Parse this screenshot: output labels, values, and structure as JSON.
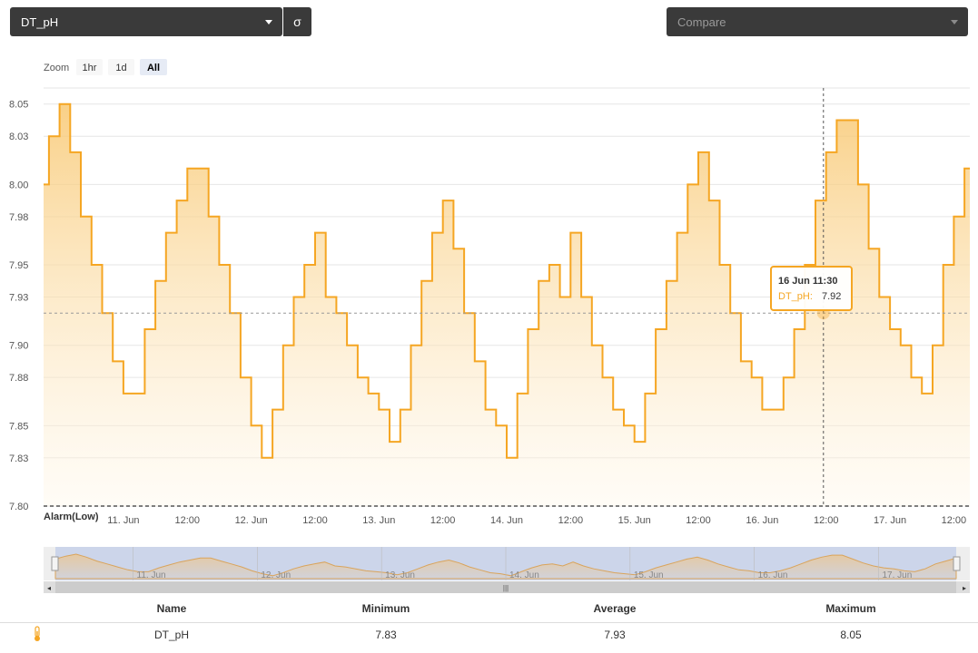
{
  "toolbar": {
    "sensor_selected": "DT_pH",
    "sigma_label": "σ",
    "compare_placeholder": "Compare"
  },
  "zoom": {
    "label": "Zoom",
    "buttons": [
      "1hr",
      "1d",
      "All"
    ],
    "active": "All"
  },
  "tooltip": {
    "date": "16 Jun 11:30",
    "series": "DT_pH:",
    "value": "7.92"
  },
  "alarm_label": "Alarm(Low)",
  "navigator_labels": [
    "11. Jun",
    "12. Jun",
    "13. Jun",
    "14. Jun",
    "15. Jun",
    "16. Jun",
    "17. Jun"
  ],
  "stats": {
    "headers": {
      "name": "Name",
      "minimum": "Minimum",
      "average": "Average",
      "maximum": "Maximum"
    },
    "row": {
      "name": "DT_pH",
      "minimum": "7.83",
      "average": "7.93",
      "maximum": "8.05"
    }
  },
  "colors": {
    "series": "#f5a623",
    "alarm": "#555555",
    "navigator_bg": "#ccd5ea",
    "dark": "#3a3a3a"
  },
  "chart_data": {
    "type": "area",
    "series": [
      {
        "name": "DT_pH",
        "points": [
          [
            "10 Jun 09:00",
            8.0
          ],
          [
            "10 Jun 11:00",
            8.03
          ],
          [
            "10 Jun 13:00",
            8.05
          ],
          [
            "10 Jun 15:00",
            8.02
          ],
          [
            "10 Jun 17:00",
            7.98
          ],
          [
            "10 Jun 19:00",
            7.95
          ],
          [
            "10 Jun 21:00",
            7.92
          ],
          [
            "10 Jun 23:00",
            7.89
          ],
          [
            "11 Jun 01:00",
            7.87
          ],
          [
            "11 Jun 03:00",
            7.87
          ],
          [
            "11 Jun 05:00",
            7.91
          ],
          [
            "11 Jun 07:00",
            7.94
          ],
          [
            "11 Jun 09:00",
            7.97
          ],
          [
            "11 Jun 11:00",
            7.99
          ],
          [
            "11 Jun 13:00",
            8.01
          ],
          [
            "11 Jun 15:00",
            8.01
          ],
          [
            "11 Jun 17:00",
            7.98
          ],
          [
            "11 Jun 19:00",
            7.95
          ],
          [
            "11 Jun 21:00",
            7.92
          ],
          [
            "11 Jun 23:00",
            7.88
          ],
          [
            "12 Jun 01:00",
            7.85
          ],
          [
            "12 Jun 03:00",
            7.83
          ],
          [
            "12 Jun 05:00",
            7.86
          ],
          [
            "12 Jun 07:00",
            7.9
          ],
          [
            "12 Jun 09:00",
            7.93
          ],
          [
            "12 Jun 11:00",
            7.95
          ],
          [
            "12 Jun 13:00",
            7.97
          ],
          [
            "12 Jun 15:00",
            7.93
          ],
          [
            "12 Jun 17:00",
            7.92
          ],
          [
            "12 Jun 19:00",
            7.9
          ],
          [
            "12 Jun 21:00",
            7.88
          ],
          [
            "12 Jun 23:00",
            7.87
          ],
          [
            "13 Jun 01:00",
            7.86
          ],
          [
            "13 Jun 03:00",
            7.84
          ],
          [
            "13 Jun 05:00",
            7.86
          ],
          [
            "13 Jun 07:00",
            7.9
          ],
          [
            "13 Jun 09:00",
            7.94
          ],
          [
            "13 Jun 11:00",
            7.97
          ],
          [
            "13 Jun 13:00",
            7.99
          ],
          [
            "13 Jun 15:00",
            7.96
          ],
          [
            "13 Jun 17:00",
            7.92
          ],
          [
            "13 Jun 19:00",
            7.89
          ],
          [
            "13 Jun 21:00",
            7.86
          ],
          [
            "13 Jun 23:00",
            7.85
          ],
          [
            "14 Jun 01:00",
            7.83
          ],
          [
            "14 Jun 03:00",
            7.87
          ],
          [
            "14 Jun 05:00",
            7.91
          ],
          [
            "14 Jun 07:00",
            7.94
          ],
          [
            "14 Jun 09:00",
            7.95
          ],
          [
            "14 Jun 11:00",
            7.93
          ],
          [
            "14 Jun 13:00",
            7.97
          ],
          [
            "14 Jun 15:00",
            7.93
          ],
          [
            "14 Jun 17:00",
            7.9
          ],
          [
            "14 Jun 19:00",
            7.88
          ],
          [
            "14 Jun 21:00",
            7.86
          ],
          [
            "14 Jun 23:00",
            7.85
          ],
          [
            "15 Jun 01:00",
            7.84
          ],
          [
            "15 Jun 03:00",
            7.87
          ],
          [
            "15 Jun 05:00",
            7.91
          ],
          [
            "15 Jun 07:00",
            7.94
          ],
          [
            "15 Jun 09:00",
            7.97
          ],
          [
            "15 Jun 11:00",
            8.0
          ],
          [
            "15 Jun 13:00",
            8.02
          ],
          [
            "15 Jun 15:00",
            7.99
          ],
          [
            "15 Jun 17:00",
            7.95
          ],
          [
            "15 Jun 19:00",
            7.92
          ],
          [
            "15 Jun 21:00",
            7.89
          ],
          [
            "15 Jun 23:00",
            7.88
          ],
          [
            "16 Jun 01:00",
            7.86
          ],
          [
            "16 Jun 03:00",
            7.86
          ],
          [
            "16 Jun 05:00",
            7.88
          ],
          [
            "16 Jun 07:00",
            7.91
          ],
          [
            "16 Jun 09:00",
            7.95
          ],
          [
            "16 Jun 11:00",
            7.99
          ],
          [
            "16 Jun 13:00",
            8.02
          ],
          [
            "16 Jun 15:00",
            8.04
          ],
          [
            "16 Jun 17:00",
            8.04
          ],
          [
            "16 Jun 19:00",
            8.0
          ],
          [
            "16 Jun 21:00",
            7.96
          ],
          [
            "16 Jun 23:00",
            7.93
          ],
          [
            "17 Jun 01:00",
            7.91
          ],
          [
            "17 Jun 03:00",
            7.9
          ],
          [
            "17 Jun 05:00",
            7.88
          ],
          [
            "17 Jun 07:00",
            7.87
          ],
          [
            "17 Jun 09:00",
            7.9
          ],
          [
            "17 Jun 11:00",
            7.95
          ],
          [
            "17 Jun 13:00",
            7.98
          ],
          [
            "17 Jun 15:00",
            8.01
          ]
        ]
      }
    ],
    "xlabel": "",
    "ylabel": "",
    "x_start": "10 Jun 09:00",
    "x_end": "17 Jun 15:00",
    "ylim": [
      7.8,
      8.06
    ],
    "y_ticks": [
      "7.80",
      "7.83",
      "7.85",
      "7.88",
      "7.90",
      "7.93",
      "7.95",
      "7.98",
      "8.00",
      "8.03",
      "8.05"
    ],
    "x_ticks": [
      "11. Jun",
      "12:00",
      "12. Jun",
      "12:00",
      "13. Jun",
      "12:00",
      "14. Jun",
      "12:00",
      "15. Jun",
      "12:00",
      "16. Jun",
      "12:00",
      "17. Jun",
      "12:00"
    ],
    "alarm_low": 7.8,
    "crosshair": {
      "x": "16 Jun 11:30",
      "y": 7.92
    },
    "grid": true,
    "legend": "none"
  }
}
